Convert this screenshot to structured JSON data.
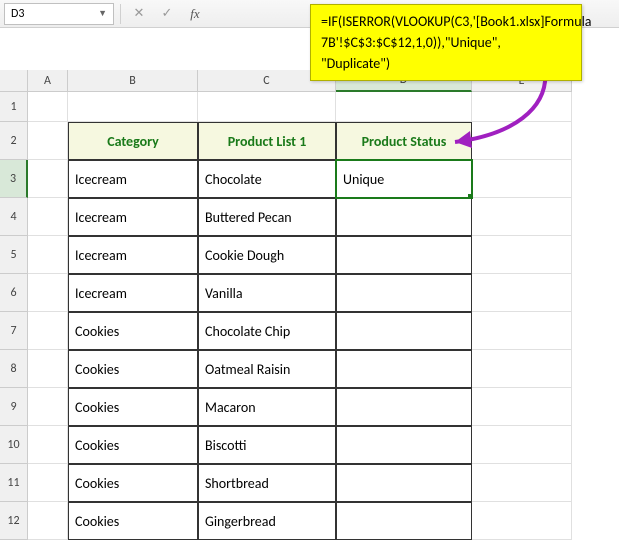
{
  "namebox": {
    "value": "D3"
  },
  "formula_callout": "=IF(ISERROR(VLOOKUP(C3,'[Book1.xlsx]Formula 7B'!$C$3:$C$12,1,0)),\"Unique\", \"Duplicate\")",
  "columns": [
    "A",
    "B",
    "C",
    "D",
    "E"
  ],
  "row_numbers": [
    "1",
    "2",
    "3",
    "4",
    "5",
    "6",
    "7",
    "8",
    "9",
    "10",
    "11",
    "12"
  ],
  "selected_col": "D",
  "selected_row": "3",
  "headers": {
    "B": "Category",
    "C": "Product List 1",
    "D": "Product Status"
  },
  "rows": [
    {
      "B": "Icecream",
      "C": "Chocolate",
      "D": "Unique"
    },
    {
      "B": "Icecream",
      "C": "Buttered Pecan",
      "D": ""
    },
    {
      "B": "Icecream",
      "C": "Cookie Dough",
      "D": ""
    },
    {
      "B": "Icecream",
      "C": "Vanilla",
      "D": ""
    },
    {
      "B": "Cookies",
      "C": "Chocolate Chip",
      "D": ""
    },
    {
      "B": "Cookies",
      "C": "Oatmeal Raisin",
      "D": ""
    },
    {
      "B": "Cookies",
      "C": "Macaron",
      "D": ""
    },
    {
      "B": "Cookies",
      "C": "Biscotti",
      "D": ""
    },
    {
      "B": "Cookies",
      "C": "Shortbread",
      "D": ""
    },
    {
      "B": "Cookies",
      "C": "Gingerbread",
      "D": ""
    }
  ]
}
